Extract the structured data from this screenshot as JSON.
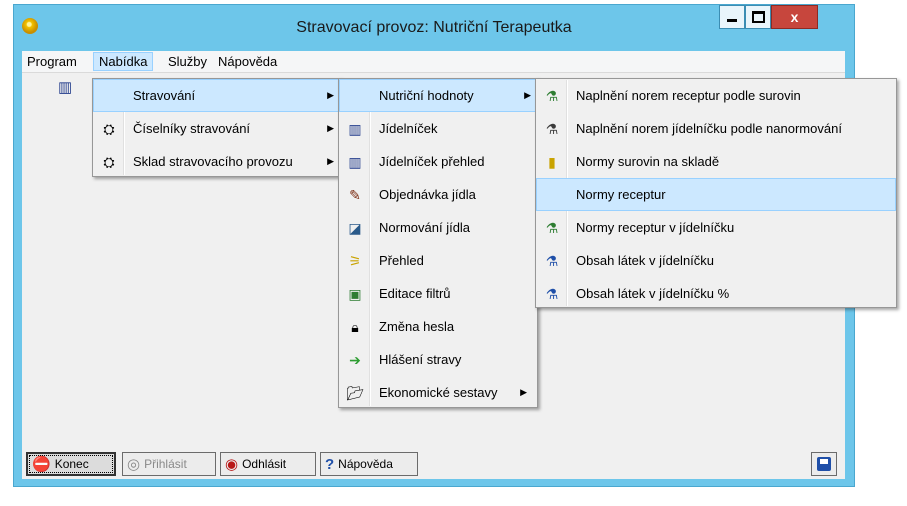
{
  "window": {
    "title": "Stravovací provoz: Nutriční Terapeutka",
    "close_label": "x"
  },
  "menubar": {
    "items": [
      "Program",
      "Nabídka",
      "Služby",
      "Nápověda"
    ]
  },
  "menu_nabidka": [
    {
      "label": "Stravování",
      "icon": "",
      "submenu": true
    },
    {
      "label": "Číselníky stravování",
      "icon": "catalog-icon",
      "submenu": true
    },
    {
      "label": "Sklad stravovacího provozu",
      "icon": "warehouse-icon",
      "submenu": true
    }
  ],
  "menu_stravovani": [
    {
      "label": "Nutriční hodnoty",
      "icon": "",
      "submenu": true
    },
    {
      "label": "Jídelníček",
      "icon": "book-icon"
    },
    {
      "label": "Jídelníček přehled",
      "icon": "book-icon"
    },
    {
      "label": "Objednávka jídla",
      "icon": "order-icon"
    },
    {
      "label": "Normování jídla",
      "icon": "norm-icon"
    },
    {
      "label": "Přehled",
      "icon": "overview-icon"
    },
    {
      "label": "Editace filtrů",
      "icon": "filter-icon"
    },
    {
      "label": "Změna hesla",
      "icon": "lock-icon"
    },
    {
      "label": "Hlášení stravy",
      "icon": "report-icon"
    },
    {
      "label": "Ekonomické sestavy",
      "icon": "folder-icon",
      "submenu": true
    }
  ],
  "menu_nutricni": [
    {
      "label": "Naplnění norem receptur podle surovin",
      "icon": "recipe-icon"
    },
    {
      "label": "Naplnění norem jídelníčku podle nanormování",
      "icon": "beaker-icon"
    },
    {
      "label": "Normy surovin na skladě",
      "icon": "jar-icon"
    },
    {
      "label": "Normy receptur",
      "icon": ""
    },
    {
      "label": "Normy receptur v jídelníčku",
      "icon": "flask-icon"
    },
    {
      "label": "Obsah látek v jídelníčku",
      "icon": "flask-icon"
    },
    {
      "label": "Obsah látek v jídelníčku %",
      "icon": "flask-icon"
    }
  ],
  "bottom_buttons": {
    "konec": "Konec",
    "prihlasit": "Přihlásit",
    "odhlasit": "Odhlásit",
    "napoveda": "Nápověda"
  },
  "colors": {
    "window_frame": "#6dc6ea",
    "highlight": "#cce8ff",
    "close_button": "#c7463d"
  }
}
